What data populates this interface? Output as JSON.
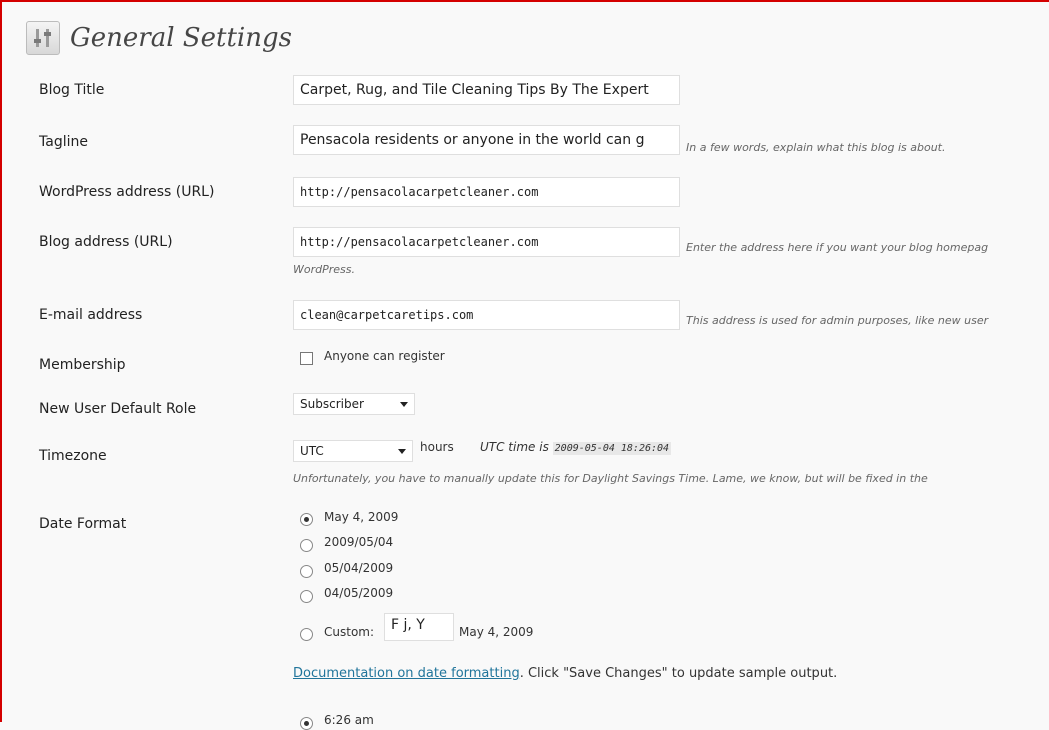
{
  "page": {
    "title": "General Settings"
  },
  "blog_title": {
    "label": "Blog Title",
    "value": "Carpet, Rug, and Tile Cleaning Tips By The Expert"
  },
  "tagline": {
    "label": "Tagline",
    "value": "Pensacola residents or anyone in the world can g",
    "description": "In a few words, explain what this blog is about."
  },
  "wp_address": {
    "label": "WordPress address (URL)",
    "value": "http://pensacolacarpetcleaner.com"
  },
  "blog_address": {
    "label": "Blog address (URL)",
    "value": "http://pensacolacarpetcleaner.com",
    "description": "Enter the address here if you want your blog homepag",
    "description_2": "WordPress."
  },
  "email": {
    "label": "E-mail address",
    "value": "clean@carpetcaretips.com",
    "description": "This address is used for admin purposes, like new user"
  },
  "membership": {
    "label": "Membership",
    "checkbox_label": "Anyone can register",
    "checked": false
  },
  "default_role": {
    "label": "New User Default Role",
    "selected": "Subscriber"
  },
  "timezone": {
    "label": "Timezone",
    "selected": "UTC",
    "unit": "hours",
    "utc_prefix": "UTC time is",
    "utc_value": "2009-05-04 18:26:04",
    "note": "Unfortunately, you have to manually update this for Daylight Savings Time. Lame, we know, but will be fixed in the"
  },
  "date_format": {
    "label": "Date Format",
    "options": [
      {
        "label": "May 4, 2009",
        "checked": true
      },
      {
        "label": "2009/05/04",
        "checked": false
      },
      {
        "label": "05/04/2009",
        "checked": false
      },
      {
        "label": "04/05/2009",
        "checked": false
      }
    ],
    "custom_label": "Custom:",
    "custom_value": "F j, Y",
    "custom_preview": "May 4, 2009",
    "doc_link": "Documentation on date formatting",
    "doc_suffix": ". Click \"Save Changes\" to update sample output."
  },
  "time_format": {
    "first_option": "6:26 am"
  }
}
